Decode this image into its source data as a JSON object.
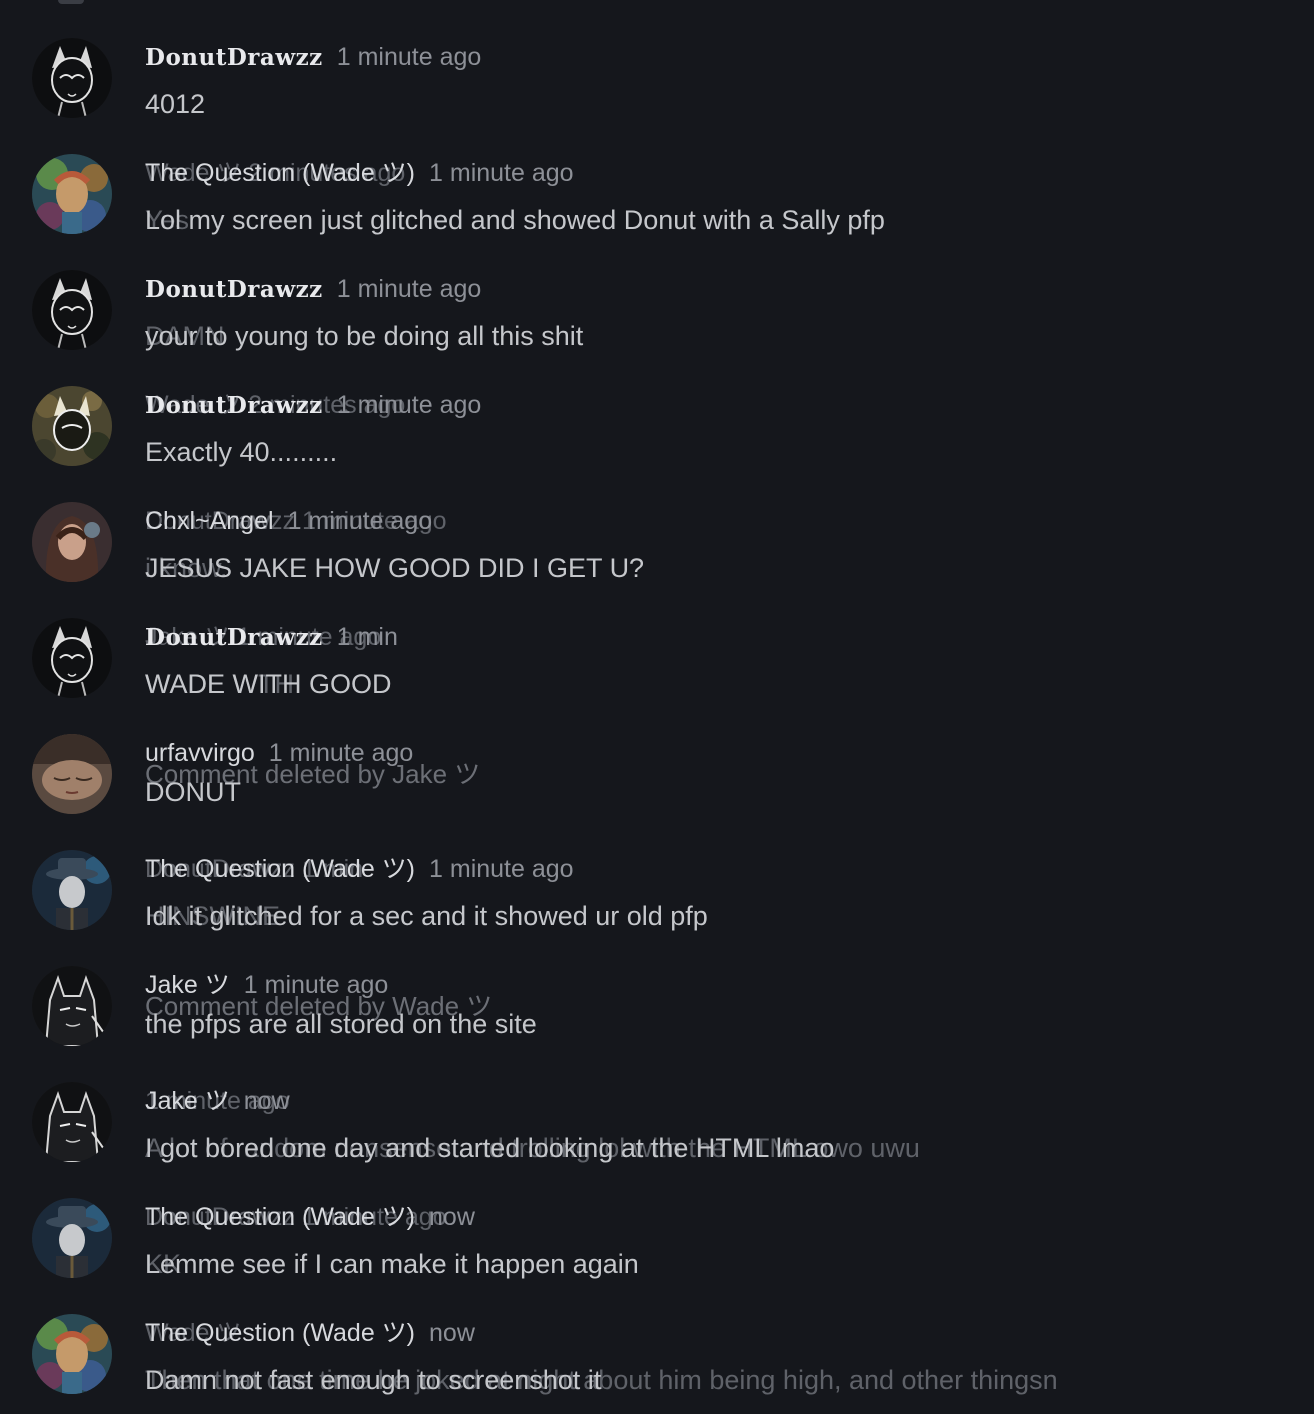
{
  "comments": [
    {
      "author": "DonutDrawzz",
      "time": "1 minute ago",
      "text": "4012",
      "ghost_header": "",
      "ghost_text": "",
      "deleted_note": "",
      "avatar": "catwoman-sketch",
      "fancy": true
    },
    {
      "author": "The Question (Wade ツ)",
      "time": "1 minute ago",
      "text": "Lol my screen just glitched and showed Donut with a Sally pfp",
      "ghost_header": "Wade ツ 2 minutes ago",
      "ghost_text": "Yes",
      "deleted_note": "",
      "avatar": "colorful-portrait",
      "fancy": false
    },
    {
      "author": "DonutDrawzz",
      "time": "1 minute ago",
      "text": "your to young to be doing all this shit",
      "ghost_header": "",
      "ghost_text": "DAMN",
      "deleted_note": "",
      "avatar": "catwoman-sketch",
      "fancy": true
    },
    {
      "author": "DonutDrawzz",
      "time": "1 minute ago",
      "text": "Exactly 40.........",
      "ghost_header": "Wade ツ 2 minutes ago",
      "ghost_text": "",
      "deleted_note": "",
      "avatar": "catwoman-camo",
      "fancy": true
    },
    {
      "author": "Chxl~Angel",
      "time": "1 minute ago",
      "text": "JESUS JAKE HOW GOOD DID I GET U?",
      "ghost_header": "DonutDrawzz 1 minute ago",
      "ghost_text": "i know.",
      "deleted_note": "",
      "avatar": "girl-photo",
      "fancy": false
    },
    {
      "author": "DonutDrawzz",
      "time": "1 min",
      "text": "WADE WITH GOOD",
      "ghost_header": "Jake ツ 1 minute ago",
      "ghost_text": "WADE WTH",
      "deleted_note": "",
      "avatar": "catwoman-sketch",
      "fancy": true
    },
    {
      "author": "urfavvirgo",
      "time": "1 minute ago",
      "text": "DONUT",
      "ghost_header": "",
      "ghost_text": "",
      "deleted_note": "Comment deleted by Jake ツ",
      "avatar": "sleeping-face",
      "fancy": false
    },
    {
      "author": "The Question (Wade ツ)",
      "time": "1 minute ago",
      "text": "Idk it glitched for a sec and it showed ur old pfp",
      "ghost_header": "DonutDrawzz 1 min",
      "ghost_text": "HINSWINE",
      "deleted_note": "",
      "avatar": "question-hat",
      "fancy": false
    },
    {
      "author": "Jake ツ",
      "time": "1 minute ago",
      "text": "the pfps are all stored on the site",
      "ghost_header": "",
      "ghost_text": "",
      "deleted_note": "Comment deleted by Wade ツ",
      "avatar": "batman-sketch",
      "fancy": false
    },
    {
      "author": "Jake ツ",
      "time": "now",
      "text": "I got bored one day and started looking at the HTML lmao",
      "ghost_header": "1 minute ago",
      "ghost_text": "A lot of random nonsense and trolling lol with the HTML owo uwu",
      "deleted_note": "",
      "avatar": "batman-sketch",
      "fancy": false
    },
    {
      "author": "The Question (Wade ツ)",
      "time": "now",
      "text": "Lemme see if I can make it happen again",
      "ghost_header": "DonutDrawzz 1 minute ago",
      "ghost_text": "KK",
      "deleted_note": "",
      "avatar": "question-hat",
      "fancy": false
    },
    {
      "author": "The Question (Wade ツ)",
      "time": "now",
      "text": "Damn not fast enough to screenshot it",
      "ghost_header": "Wade ツ",
      "ghost_text": "Then that one time he joked at night about him being high, and other thingsn",
      "deleted_note": "",
      "avatar": "colorful-portrait",
      "fancy": false
    }
  ],
  "colors": {
    "background": "#15171c",
    "author_text": "#d7d9dd",
    "time_text": "#8d9097",
    "body_text": "#c5c7cb",
    "ghost_text": "#6d7077"
  }
}
